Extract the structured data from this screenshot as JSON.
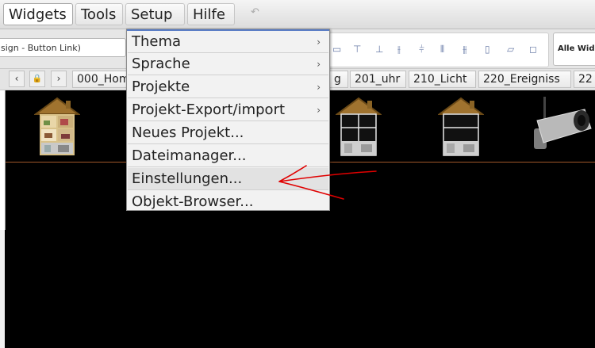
{
  "menubar": {
    "tabs": [
      {
        "label": "Widgets"
      },
      {
        "label": "Tools"
      },
      {
        "label": "Setup"
      },
      {
        "label": "Hilfe"
      }
    ],
    "undo_glyph": "↶"
  },
  "toolbar": {
    "widget_name": "sign - Button Link)",
    "all_widgets_label": "Alle Widg"
  },
  "views": {
    "nav_prev": "‹",
    "nav_lock": "🔒",
    "nav_next": "›",
    "tabs": [
      {
        "label": "000_Hom"
      },
      {
        "label": "g"
      },
      {
        "label": "201_uhr"
      },
      {
        "label": "210_Licht"
      },
      {
        "label": "220_Ereigniss"
      },
      {
        "label": "22"
      }
    ]
  },
  "setup_menu": {
    "items": [
      {
        "label": "Thema",
        "submenu": true
      },
      {
        "label": "Sprache",
        "submenu": true
      },
      {
        "label": "Projekte",
        "submenu": true
      },
      {
        "label": "Projekt-Export/import",
        "submenu": true
      },
      {
        "label": "Neues Projekt...",
        "submenu": false
      },
      {
        "label": "Dateimanager...",
        "submenu": false
      },
      {
        "label": "Einstellungen...",
        "submenu": false
      },
      {
        "label": "Objekt-Browser...",
        "submenu": false
      }
    ],
    "submenu_arrow": "›"
  },
  "colors": {
    "accent": "#5b7ec6",
    "annotation": "#e00000",
    "canvas_bg": "#000000"
  }
}
